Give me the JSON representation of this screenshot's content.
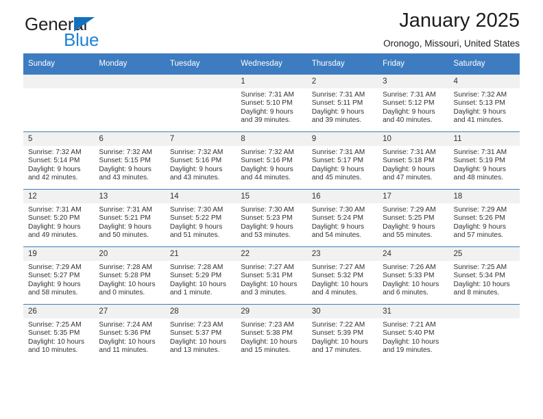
{
  "brand": {
    "name_dark": "General",
    "name_light": "Blue",
    "triangle_color": "#1271bd",
    "light_color": "#1d82d4"
  },
  "header": {
    "title": "January 2025",
    "subtitle": "Oronogo, Missouri, United States"
  },
  "theme": {
    "header_blue": "#3d7cc0",
    "daynum_gray": "#f1f1f1",
    "text": "#303030"
  },
  "calendar": {
    "weekday_headers": [
      "Sunday",
      "Monday",
      "Tuesday",
      "Wednesday",
      "Thursday",
      "Friday",
      "Saturday"
    ],
    "labels": {
      "sunrise": "Sunrise:",
      "sunset": "Sunset:",
      "daylight": "Daylight:"
    },
    "weeks": [
      [
        {
          "day": "",
          "empty": true
        },
        {
          "day": "",
          "empty": true
        },
        {
          "day": "",
          "empty": true
        },
        {
          "day": "1",
          "sunrise": "Sunrise: 7:31 AM",
          "sunset": "Sunset: 5:10 PM",
          "daylight_1": "Daylight: 9 hours",
          "daylight_2": "and 39 minutes."
        },
        {
          "day": "2",
          "sunrise": "Sunrise: 7:31 AM",
          "sunset": "Sunset: 5:11 PM",
          "daylight_1": "Daylight: 9 hours",
          "daylight_2": "and 39 minutes."
        },
        {
          "day": "3",
          "sunrise": "Sunrise: 7:31 AM",
          "sunset": "Sunset: 5:12 PM",
          "daylight_1": "Daylight: 9 hours",
          "daylight_2": "and 40 minutes."
        },
        {
          "day": "4",
          "sunrise": "Sunrise: 7:32 AM",
          "sunset": "Sunset: 5:13 PM",
          "daylight_1": "Daylight: 9 hours",
          "daylight_2": "and 41 minutes."
        }
      ],
      [
        {
          "day": "5",
          "sunrise": "Sunrise: 7:32 AM",
          "sunset": "Sunset: 5:14 PM",
          "daylight_1": "Daylight: 9 hours",
          "daylight_2": "and 42 minutes."
        },
        {
          "day": "6",
          "sunrise": "Sunrise: 7:32 AM",
          "sunset": "Sunset: 5:15 PM",
          "daylight_1": "Daylight: 9 hours",
          "daylight_2": "and 43 minutes."
        },
        {
          "day": "7",
          "sunrise": "Sunrise: 7:32 AM",
          "sunset": "Sunset: 5:16 PM",
          "daylight_1": "Daylight: 9 hours",
          "daylight_2": "and 43 minutes."
        },
        {
          "day": "8",
          "sunrise": "Sunrise: 7:32 AM",
          "sunset": "Sunset: 5:16 PM",
          "daylight_1": "Daylight: 9 hours",
          "daylight_2": "and 44 minutes."
        },
        {
          "day": "9",
          "sunrise": "Sunrise: 7:31 AM",
          "sunset": "Sunset: 5:17 PM",
          "daylight_1": "Daylight: 9 hours",
          "daylight_2": "and 45 minutes."
        },
        {
          "day": "10",
          "sunrise": "Sunrise: 7:31 AM",
          "sunset": "Sunset: 5:18 PM",
          "daylight_1": "Daylight: 9 hours",
          "daylight_2": "and 47 minutes."
        },
        {
          "day": "11",
          "sunrise": "Sunrise: 7:31 AM",
          "sunset": "Sunset: 5:19 PM",
          "daylight_1": "Daylight: 9 hours",
          "daylight_2": "and 48 minutes."
        }
      ],
      [
        {
          "day": "12",
          "sunrise": "Sunrise: 7:31 AM",
          "sunset": "Sunset: 5:20 PM",
          "daylight_1": "Daylight: 9 hours",
          "daylight_2": "and 49 minutes."
        },
        {
          "day": "13",
          "sunrise": "Sunrise: 7:31 AM",
          "sunset": "Sunset: 5:21 PM",
          "daylight_1": "Daylight: 9 hours",
          "daylight_2": "and 50 minutes."
        },
        {
          "day": "14",
          "sunrise": "Sunrise: 7:30 AM",
          "sunset": "Sunset: 5:22 PM",
          "daylight_1": "Daylight: 9 hours",
          "daylight_2": "and 51 minutes."
        },
        {
          "day": "15",
          "sunrise": "Sunrise: 7:30 AM",
          "sunset": "Sunset: 5:23 PM",
          "daylight_1": "Daylight: 9 hours",
          "daylight_2": "and 53 minutes."
        },
        {
          "day": "16",
          "sunrise": "Sunrise: 7:30 AM",
          "sunset": "Sunset: 5:24 PM",
          "daylight_1": "Daylight: 9 hours",
          "daylight_2": "and 54 minutes."
        },
        {
          "day": "17",
          "sunrise": "Sunrise: 7:29 AM",
          "sunset": "Sunset: 5:25 PM",
          "daylight_1": "Daylight: 9 hours",
          "daylight_2": "and 55 minutes."
        },
        {
          "day": "18",
          "sunrise": "Sunrise: 7:29 AM",
          "sunset": "Sunset: 5:26 PM",
          "daylight_1": "Daylight: 9 hours",
          "daylight_2": "and 57 minutes."
        }
      ],
      [
        {
          "day": "19",
          "sunrise": "Sunrise: 7:29 AM",
          "sunset": "Sunset: 5:27 PM",
          "daylight_1": "Daylight: 9 hours",
          "daylight_2": "and 58 minutes."
        },
        {
          "day": "20",
          "sunrise": "Sunrise: 7:28 AM",
          "sunset": "Sunset: 5:28 PM",
          "daylight_1": "Daylight: 10 hours",
          "daylight_2": "and 0 minutes."
        },
        {
          "day": "21",
          "sunrise": "Sunrise: 7:28 AM",
          "sunset": "Sunset: 5:29 PM",
          "daylight_1": "Daylight: 10 hours",
          "daylight_2": "and 1 minute."
        },
        {
          "day": "22",
          "sunrise": "Sunrise: 7:27 AM",
          "sunset": "Sunset: 5:31 PM",
          "daylight_1": "Daylight: 10 hours",
          "daylight_2": "and 3 minutes."
        },
        {
          "day": "23",
          "sunrise": "Sunrise: 7:27 AM",
          "sunset": "Sunset: 5:32 PM",
          "daylight_1": "Daylight: 10 hours",
          "daylight_2": "and 4 minutes."
        },
        {
          "day": "24",
          "sunrise": "Sunrise: 7:26 AM",
          "sunset": "Sunset: 5:33 PM",
          "daylight_1": "Daylight: 10 hours",
          "daylight_2": "and 6 minutes."
        },
        {
          "day": "25",
          "sunrise": "Sunrise: 7:25 AM",
          "sunset": "Sunset: 5:34 PM",
          "daylight_1": "Daylight: 10 hours",
          "daylight_2": "and 8 minutes."
        }
      ],
      [
        {
          "day": "26",
          "sunrise": "Sunrise: 7:25 AM",
          "sunset": "Sunset: 5:35 PM",
          "daylight_1": "Daylight: 10 hours",
          "daylight_2": "and 10 minutes."
        },
        {
          "day": "27",
          "sunrise": "Sunrise: 7:24 AM",
          "sunset": "Sunset: 5:36 PM",
          "daylight_1": "Daylight: 10 hours",
          "daylight_2": "and 11 minutes."
        },
        {
          "day": "28",
          "sunrise": "Sunrise: 7:23 AM",
          "sunset": "Sunset: 5:37 PM",
          "daylight_1": "Daylight: 10 hours",
          "daylight_2": "and 13 minutes."
        },
        {
          "day": "29",
          "sunrise": "Sunrise: 7:23 AM",
          "sunset": "Sunset: 5:38 PM",
          "daylight_1": "Daylight: 10 hours",
          "daylight_2": "and 15 minutes."
        },
        {
          "day": "30",
          "sunrise": "Sunrise: 7:22 AM",
          "sunset": "Sunset: 5:39 PM",
          "daylight_1": "Daylight: 10 hours",
          "daylight_2": "and 17 minutes."
        },
        {
          "day": "31",
          "sunrise": "Sunrise: 7:21 AM",
          "sunset": "Sunset: 5:40 PM",
          "daylight_1": "Daylight: 10 hours",
          "daylight_2": "and 19 minutes."
        },
        {
          "day": "",
          "empty": true
        }
      ]
    ]
  }
}
